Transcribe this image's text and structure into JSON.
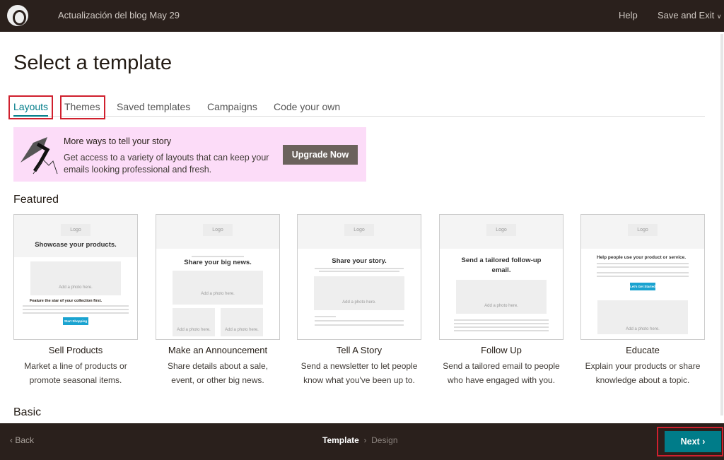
{
  "header": {
    "campaign_title": "Actualización del blog May 29",
    "help": "Help",
    "save_exit": "Save and Exit",
    "save_exit_icon": "chevron-down-icon"
  },
  "page_title": "Select a template",
  "tabs": [
    {
      "label": "Layouts",
      "active": true
    },
    {
      "label": "Themes"
    },
    {
      "label": "Saved templates"
    },
    {
      "label": "Campaigns"
    },
    {
      "label": "Code your own"
    }
  ],
  "banner": {
    "title": "More ways to tell your story",
    "description": "Get access to a variety of layouts that can keep your emails looking professional and fresh.",
    "button": "Upgrade Now"
  },
  "featured_heading": "Featured",
  "basic_heading": "Basic",
  "templates": [
    {
      "name": "Sell Products",
      "description": "Market a line of products or promote seasonal items.",
      "preview": {
        "logo": "Logo",
        "heading": "Showcase your products.",
        "photo": "Add a photo here.",
        "subheading": "Feature the star of your collection first.",
        "button": "Start Shopping"
      }
    },
    {
      "name": "Make an Announcement",
      "description": "Share details about a sale, event, or other big news.",
      "preview": {
        "logo": "Logo",
        "heading": "Share your big news.",
        "photo": "Add a photo here.",
        "photo2": "Add a photo here.",
        "photo3": "Add a photo here."
      }
    },
    {
      "name": "Tell A Story",
      "description": "Send a newsletter to let people know what you've been up to.",
      "preview": {
        "logo": "Logo",
        "heading": "Share your story.",
        "photo": "Add a photo here."
      }
    },
    {
      "name": "Follow Up",
      "description": "Send a tailored email to people who have engaged with you.",
      "preview": {
        "logo": "Logo",
        "heading": "Send a tailored follow-up email.",
        "photo": "Add a photo here."
      }
    },
    {
      "name": "Educate",
      "description": "Explain your products or share knowledge about a topic.",
      "preview": {
        "logo": "Logo",
        "heading": "Help people use your product or service.",
        "button": "Let's Get Started",
        "photo": "Add a photo here."
      }
    }
  ],
  "footer": {
    "back": "‹ Back",
    "step_current": "Template",
    "step_separator": "›",
    "step_next": "Design",
    "next": "Next ›"
  },
  "colors": {
    "accent": "#007c89",
    "header_bg": "#2a201c",
    "banner_bg": "#fcdcf8",
    "highlight": "#d0202e"
  }
}
